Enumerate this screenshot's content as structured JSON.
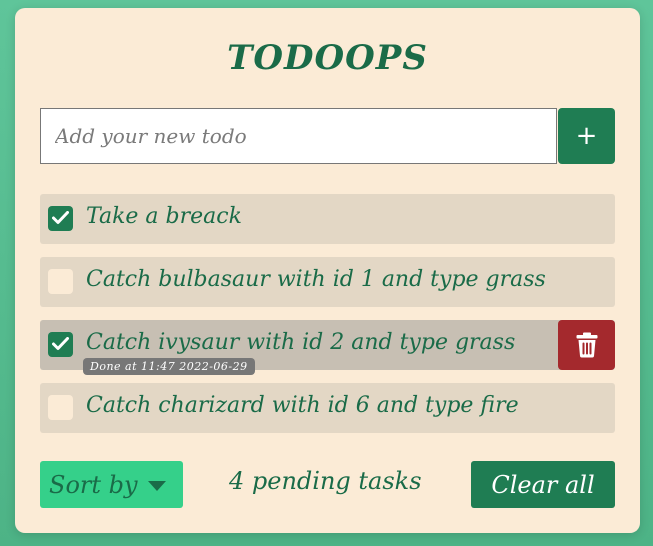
{
  "app": {
    "title": "TODOOPS"
  },
  "new_todo": {
    "placeholder": "Add your new todo",
    "value": "",
    "add_label": "+"
  },
  "todos": [
    {
      "text": "Take a breack",
      "done": true,
      "done_at": ""
    },
    {
      "text": "Catch bulbasaur with id 1 and type grass",
      "done": false,
      "done_at": ""
    },
    {
      "text": "Catch ivysaur with id 2 and type grass",
      "done": true,
      "done_at": "Done at 11:47 2022-06-29"
    },
    {
      "text": "Catch charizard with id 6 and type fire",
      "done": false,
      "done_at": ""
    }
  ],
  "footer": {
    "sort_label": "Sort by",
    "pending_text": "4 pending tasks",
    "clear_label": "Clear all"
  },
  "icons": {
    "add": "plus-icon",
    "check": "check-icon",
    "delete": "trash-icon",
    "sort": "caret-down-icon"
  },
  "colors": {
    "primary": "#1f7d53",
    "accent": "#35d08a",
    "danger": "#a4292d",
    "card": "#fbebd6",
    "item": "#e3d7c5",
    "text": "#1a6b48"
  }
}
